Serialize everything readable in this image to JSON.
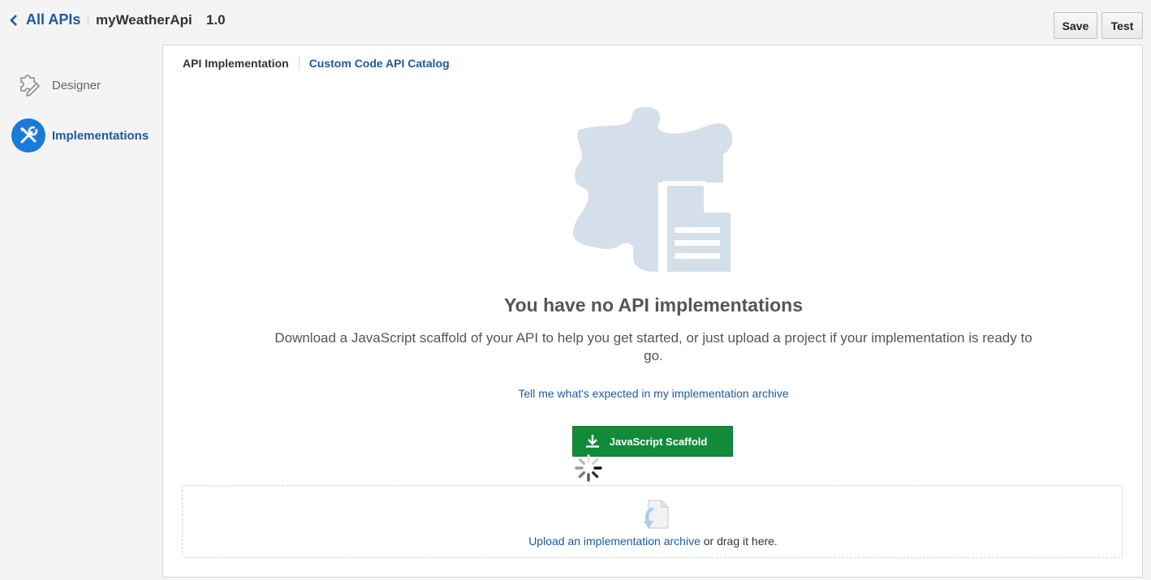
{
  "header": {
    "back_label": "All APIs",
    "api_name": "myWeatherApi",
    "api_version": "1.0",
    "save_label": "Save",
    "test_label": "Test"
  },
  "sidebar": {
    "items": [
      {
        "label": "Designer",
        "icon": "designer-icon",
        "active": false
      },
      {
        "label": "Implementations",
        "icon": "tools-icon",
        "active": true
      }
    ]
  },
  "tabs": [
    {
      "label": "API Implementation",
      "active": true
    },
    {
      "label": "Custom Code API Catalog",
      "active": false
    }
  ],
  "empty_state": {
    "title": "You have no API implementations",
    "description": "Download a JavaScript scaffold of your API to help you get started, or just upload a project if your implementation is ready to go.",
    "help_link": "Tell me what's expected in my implementation archive",
    "scaffold_button": "JavaScript Scaffold"
  },
  "upload": {
    "link_text": "Upload an implementation archive",
    "suffix_text": " or drag it here."
  },
  "colors": {
    "brand_blue": "#1d5a9e",
    "active_nav_bg": "#1b7ad8",
    "scaffold_green": "#118a3a",
    "hero_icon": "#d4dfe9"
  }
}
